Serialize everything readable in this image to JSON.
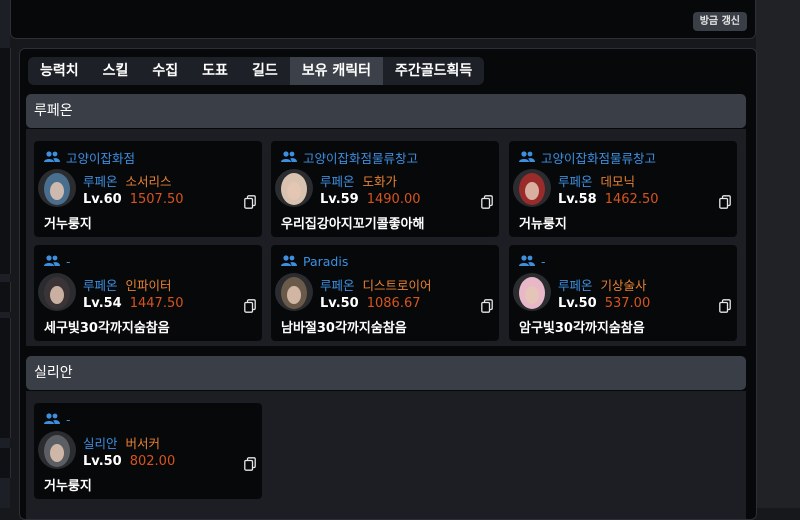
{
  "header": {
    "refresh_label": "방금 갱신"
  },
  "tabs": [
    {
      "label": "능력치",
      "active": false
    },
    {
      "label": "스킬",
      "active": false
    },
    {
      "label": "수집",
      "active": false
    },
    {
      "label": "도표",
      "active": false
    },
    {
      "label": "길드",
      "active": false
    },
    {
      "label": "보유 캐릭터",
      "active": true
    },
    {
      "label": "주간골드획득",
      "active": false
    }
  ],
  "groups": [
    {
      "server": "루페온",
      "characters": [
        {
          "guild": "고양이잡화점",
          "server": "루페온",
          "class": "소서리스",
          "level": "Lv.60",
          "item_level": "1507.50",
          "name": "거누룽지",
          "avatar_color": "#4a6f8e"
        },
        {
          "guild": "고양이잡화점물류창고",
          "server": "루페온",
          "class": "도화가",
          "level": "Lv.59",
          "item_level": "1490.00",
          "name": "우리집강아지꼬기콜좋아해",
          "avatar_color": "#d9c3b0"
        },
        {
          "guild": "고양이잡화점물류창고",
          "server": "루페온",
          "class": "데모닉",
          "level": "Lv.58",
          "item_level": "1462.50",
          "name": "거뉴룽지",
          "avatar_color": "#9a2b2b"
        },
        {
          "guild": "-",
          "server": "루페온",
          "class": "인파이터",
          "level": "Lv.54",
          "item_level": "1447.50",
          "name": "세구빛30각까지숨참음",
          "avatar_color": "#3a3436"
        },
        {
          "guild": "Paradis",
          "server": "루페온",
          "class": "디스트로이어",
          "level": "Lv.50",
          "item_level": "1086.67",
          "name": "남바절30각까지숨참음",
          "avatar_color": "#6a5a4a"
        },
        {
          "guild": "-",
          "server": "루페온",
          "class": "기상술사",
          "level": "Lv.50",
          "item_level": "537.00",
          "name": "암구빛30각까지숨참음",
          "avatar_color": "#e8b8c8"
        }
      ]
    },
    {
      "server": "실리안",
      "characters": [
        {
          "guild": "-",
          "server": "실리안",
          "class": "버서커",
          "level": "Lv.50",
          "item_level": "802.00",
          "name": "거누룽지",
          "avatar_color": "#5b5e63"
        }
      ]
    }
  ],
  "icons": {
    "guild": "users-icon",
    "copy": "copy-icon"
  },
  "colors": {
    "server": "#3d8fe0",
    "class": "#e78133",
    "item_level": "#d6541e"
  }
}
